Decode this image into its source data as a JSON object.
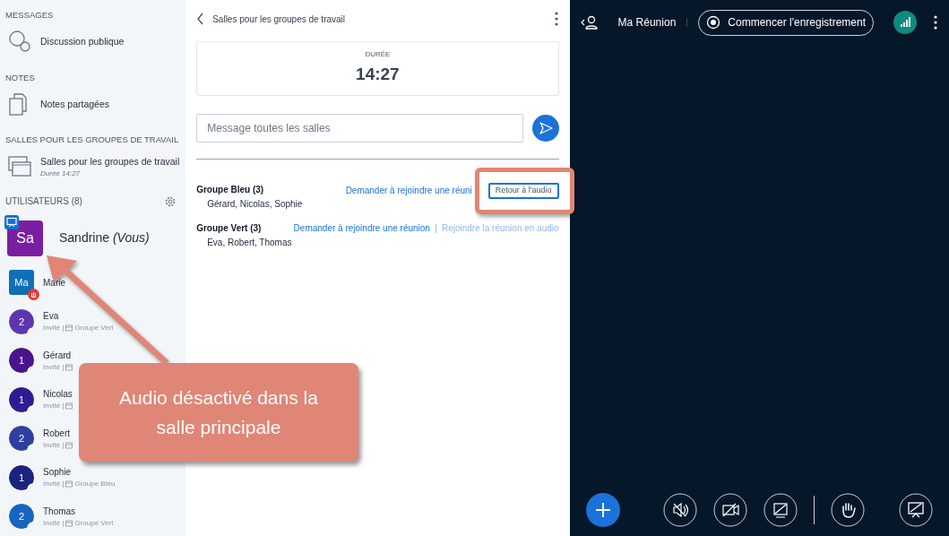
{
  "sidebar": {
    "sections": [
      {
        "heading": "MESSAGES",
        "items": [
          {
            "kind": "chat",
            "label": "Discussion publique"
          }
        ]
      },
      {
        "heading": "NOTES",
        "items": [
          {
            "kind": "notes",
            "label": "Notes partagées"
          }
        ]
      },
      {
        "heading": "SALLES POUR LES GROUPES DE TRAVAIL",
        "items": [
          {
            "kind": "rooms",
            "label": "Salles pour les groupes de travail",
            "sub": "Durée 14:27"
          }
        ]
      }
    ],
    "users_heading": "UTILISATEURS (8)",
    "users": [
      {
        "kind": "square",
        "initials": "Sa",
        "color": "#7b1fa2",
        "badge": {
          "kind": "presenter"
        },
        "name": "Sandrine *(Vous)*"
      },
      {
        "kind": "square",
        "initials": "Ma",
        "color": "#0f70b7",
        "badge": {
          "kind": "hand"
        },
        "name": "Marie"
      },
      {
        "kind": "circle",
        "initials": "2",
        "color": "#5e35b1",
        "name": "Eva",
        "role": "Invité |",
        "group": "Groupe Vert"
      },
      {
        "kind": "circle",
        "initials": "1",
        "color": "#4a148c",
        "name": "Gérard",
        "role": "Invité |"
      },
      {
        "kind": "circle",
        "initials": "1",
        "color": "#311b92",
        "name": "Nicolas",
        "role": "Invité |"
      },
      {
        "kind": "circle",
        "initials": "2",
        "color": "#303f9f",
        "name": "Robert",
        "role": "Invité |"
      },
      {
        "kind": "circle",
        "initials": "1",
        "color": "#1a237e",
        "name": "Sophie",
        "role": "Invité |",
        "group": "Groupe Bleu"
      },
      {
        "kind": "circle",
        "initials": "2",
        "color": "#1565c0",
        "name": "Thomas",
        "role": "Invité |",
        "group": "Groupe Vert"
      }
    ]
  },
  "panel": {
    "title": "Salles pour les groupes de travail",
    "duration_label": "DURÉE",
    "duration": "14:27",
    "message_placeholder": "Message toutes les salles",
    "groups": [
      {
        "name": "Groupe Bleu (3)",
        "members": "Gérard, Nicolas, Sophie",
        "actions": [
          {
            "kind": "link",
            "label": "Demander à rejoindre une réuni"
          },
          {
            "kind": "outlined",
            "label": "Retour à l'audio"
          }
        ]
      },
      {
        "name": "Groupe Vert (3)",
        "members": "Eva, Robert, Thomas",
        "actions": [
          {
            "kind": "link",
            "label": "Demander à rejoindre une réunion"
          },
          {
            "kind": "faint",
            "label": "Rejoindre la réunion en audio"
          }
        ]
      }
    ]
  },
  "meeting": {
    "title": "Ma Réunion",
    "record_label": "Commencer l'enregistrement"
  },
  "annotation": {
    "text": "Audio désactivé dans la salle principale"
  }
}
